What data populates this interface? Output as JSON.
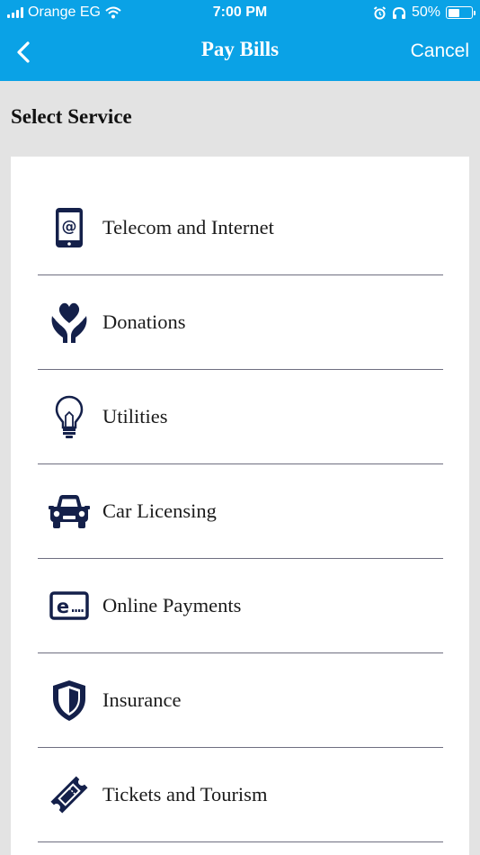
{
  "status_bar": {
    "carrier": "Orange EG",
    "time": "7:00 PM",
    "battery": "50%",
    "battery_level": 0.5
  },
  "nav": {
    "title": "Pay Bills",
    "cancel_label": "Cancel",
    "back_icon": "chevron-left-icon"
  },
  "section_title": "Select Service",
  "services": [
    {
      "label": "Telecom and Internet",
      "icon": "phone-at-icon"
    },
    {
      "label": "Donations",
      "icon": "heart-hands-icon"
    },
    {
      "label": "Utilities",
      "icon": "lightbulb-icon"
    },
    {
      "label": "Car Licensing",
      "icon": "car-icon"
    },
    {
      "label": "Online Payments",
      "icon": "e-payment-icon"
    },
    {
      "label": "Insurance",
      "icon": "shield-icon"
    },
    {
      "label": "Tickets and Tourism",
      "icon": "ticket-icon"
    }
  ],
  "colors": {
    "header_bg": "#0aa2e6",
    "icon_color": "#14204a",
    "page_bg": "#e3e3e3"
  }
}
